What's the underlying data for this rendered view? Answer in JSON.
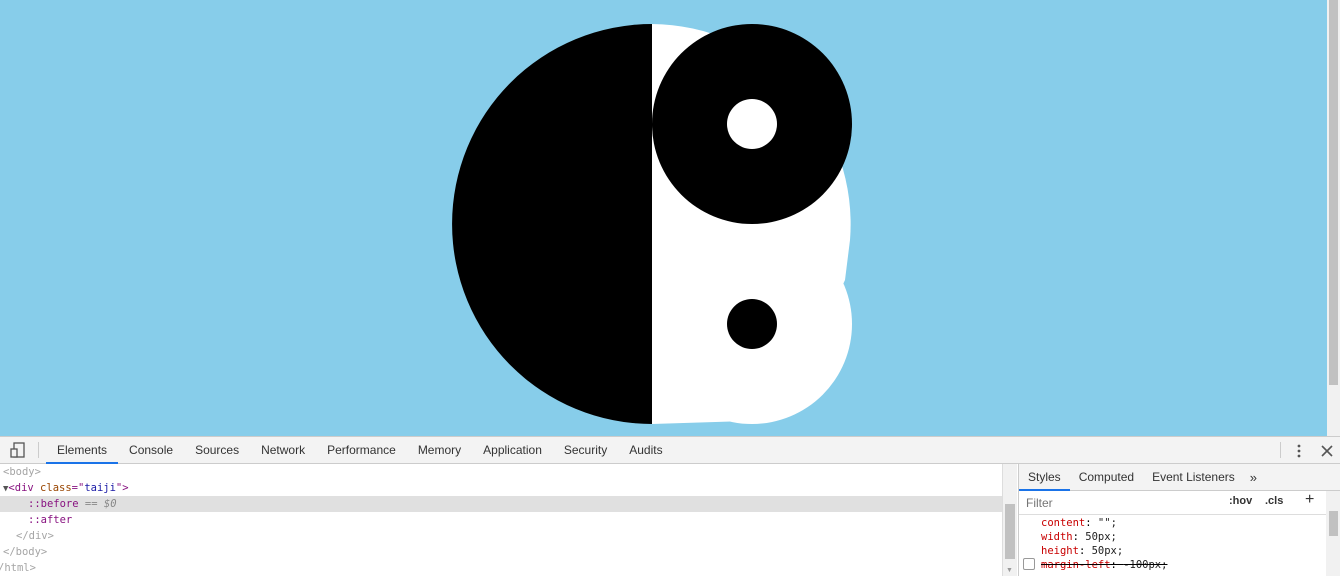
{
  "viewport": {
    "background": "#87cdea"
  },
  "devtools": {
    "tabs": [
      "Elements",
      "Console",
      "Sources",
      "Network",
      "Performance",
      "Memory",
      "Application",
      "Security",
      "Audits"
    ],
    "active_tab": "Elements",
    "elements": {
      "body_open": "<body>",
      "div_tag": "div",
      "div_attr_name": "class",
      "div_attr_value": "taiji",
      "before": "::before",
      "before_suffix": "== $0",
      "after": "::after",
      "div_close": "</div>",
      "body_close": "</body>",
      "html_close": "/html>"
    },
    "styles_panel": {
      "tabs": [
        "Styles",
        "Computed",
        "Event Listeners"
      ],
      "more_label": "»",
      "filter_placeholder": "Filter",
      "hov_label": ":hov",
      "cls_label": ".cls",
      "add_label": "+",
      "rules": [
        {
          "prop": "content",
          "value": "\"\";"
        },
        {
          "prop": "width",
          "value": "50px;"
        },
        {
          "prop": "height",
          "value": "50px;"
        },
        {
          "prop": "margin-left",
          "value": "-100px;"
        }
      ]
    }
  }
}
